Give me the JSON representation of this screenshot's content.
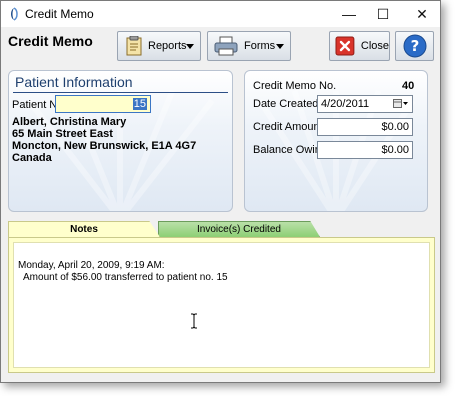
{
  "window": {
    "title": "Credit Memo",
    "controls": {
      "minimize": "—",
      "maximize": "☐",
      "close": "✕"
    }
  },
  "header": {
    "heading": "Credit Memo"
  },
  "toolbar": {
    "reports_label": "Reports",
    "forms_label": "Forms",
    "close_label": "Close"
  },
  "patient": {
    "section_title": "Patient Information",
    "patient_no_label": "Patient No",
    "patient_no_value": "15",
    "address": [
      "Albert, Christina Mary",
      "65 Main Street East",
      "Moncton, New Brunswick, E1A 4G7",
      "Canada"
    ]
  },
  "memo": {
    "number_label": "Credit Memo No.",
    "number_value": "40",
    "date_label": "Date Created",
    "date_value": "4/20/2011",
    "credit_label": "Credit Amount",
    "credit_value": "$0.00",
    "balance_label": "Balance Owing",
    "balance_value": "$0.00"
  },
  "tabs": [
    {
      "label": "Notes",
      "active": true
    },
    {
      "label": "Invoice(s) Credited",
      "active": false
    }
  ],
  "notes": {
    "lines": [
      "Monday, April 20, 2009, 9:19 AM:",
      "  Amount of $56.00 transferred to patient no. 15"
    ]
  },
  "colors": {
    "panel_title": "#1e3f6e",
    "notes_bg": "#ffffcc",
    "invoice_tab": "#8ccf74",
    "close_button_red": "#d9342b",
    "help_button_blue": "#2a6bc7",
    "field_highlight": "#ffffcc"
  },
  "icons": [
    "app-icon",
    "reports-icon",
    "printer-icon",
    "close-red-icon",
    "help-icon",
    "calendar-icon",
    "text-cursor-icon"
  ]
}
